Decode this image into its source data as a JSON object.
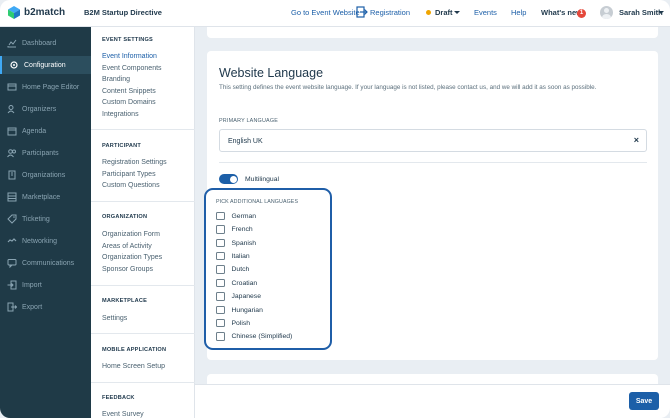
{
  "brand": {
    "name": "b2match"
  },
  "header": {
    "event_name": "B2M Startup Directive",
    "go_to_event": "Go to Event Website",
    "registration": "Registration",
    "status": "Draft",
    "events": "Events",
    "help": "Help",
    "whats_new": "What's new",
    "whats_new_count": "1",
    "user_name": "Sarah Smith",
    "status_color": "#f0a500",
    "accent_color": "#1c5fa8"
  },
  "sidebar": {
    "items": [
      {
        "label": "Dashboard",
        "icon": "dashboard-icon"
      },
      {
        "label": "Configuration",
        "icon": "gear-icon",
        "active": true
      },
      {
        "label": "Home Page Editor",
        "icon": "home-icon"
      },
      {
        "label": "Organizers",
        "icon": "organizers-icon"
      },
      {
        "label": "Agenda",
        "icon": "calendar-icon"
      },
      {
        "label": "Participants",
        "icon": "users-icon"
      },
      {
        "label": "Organizations",
        "icon": "building-icon"
      },
      {
        "label": "Marketplace",
        "icon": "marketplace-icon"
      },
      {
        "label": "Ticketing",
        "icon": "ticket-icon"
      },
      {
        "label": "Networking",
        "icon": "networking-icon"
      },
      {
        "label": "Communications",
        "icon": "chat-icon"
      },
      {
        "label": "Import",
        "icon": "import-icon"
      },
      {
        "label": "Export",
        "icon": "export-icon"
      }
    ]
  },
  "subnav": {
    "sections": [
      {
        "heading": "EVENT SETTINGS",
        "items": [
          "Event Information",
          "Event Components",
          "Branding",
          "Content Snippets",
          "Custom Domains",
          "Integrations"
        ]
      },
      {
        "heading": "PARTICIPANT",
        "items": [
          "Registration Settings",
          "Participant Types",
          "Custom Questions"
        ]
      },
      {
        "heading": "ORGANIZATION",
        "items": [
          "Organization Form",
          "Areas of Activity",
          "Organization Types",
          "Sponsor Groups"
        ]
      },
      {
        "heading": "MARKETPLACE",
        "items": [
          "Settings"
        ]
      },
      {
        "heading": "MOBILE APPLICATION",
        "items": [
          "Home Screen Setup"
        ]
      },
      {
        "heading": "FEEDBACK",
        "items": [
          "Event Survey"
        ]
      }
    ]
  },
  "main": {
    "title": "Website Language",
    "description": "This setting defines the event website language. If your language is not listed, please contact us, and we will add it as soon as possible.",
    "primary_label": "PRIMARY LANGUAGE",
    "primary_value": "English UK",
    "clear_symbol": "×",
    "multilingual_label": "Multilingual",
    "additional_label": "PICK ADDITIONAL LANGUAGES",
    "languages": [
      "German",
      "French",
      "Spanish",
      "Italian",
      "Dutch",
      "Croatian",
      "Japanese",
      "Hungarian",
      "Polish",
      "Chinese (Simplified)"
    ]
  },
  "footer": {
    "save_label": "Save"
  }
}
